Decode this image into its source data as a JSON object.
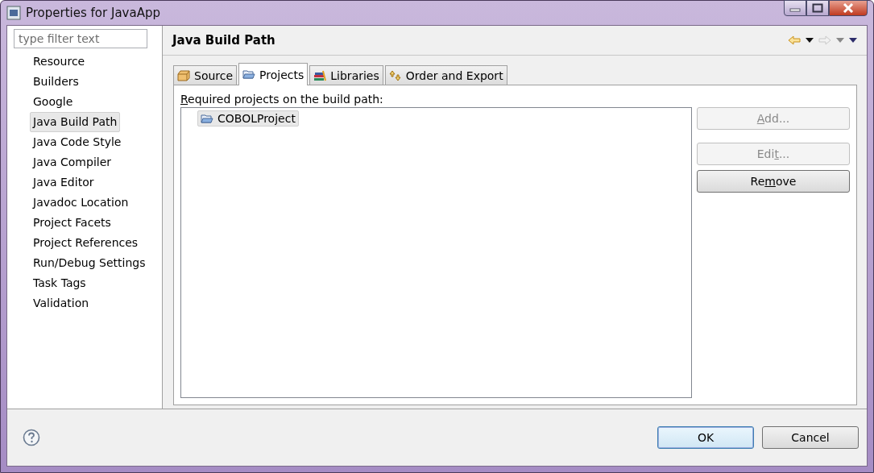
{
  "window": {
    "title": "Properties for JavaApp"
  },
  "sidebar": {
    "filter_placeholder": "type filter text",
    "items": [
      {
        "label": "Resource",
        "selected": false
      },
      {
        "label": "Builders",
        "selected": false
      },
      {
        "label": "Google",
        "selected": false
      },
      {
        "label": "Java Build Path",
        "selected": true
      },
      {
        "label": "Java Code Style",
        "selected": false
      },
      {
        "label": "Java Compiler",
        "selected": false
      },
      {
        "label": "Java Editor",
        "selected": false
      },
      {
        "label": "Javadoc Location",
        "selected": false
      },
      {
        "label": "Project Facets",
        "selected": false
      },
      {
        "label": "Project References",
        "selected": false
      },
      {
        "label": "Run/Debug Settings",
        "selected": false
      },
      {
        "label": "Task Tags",
        "selected": false
      },
      {
        "label": "Validation",
        "selected": false
      }
    ]
  },
  "page": {
    "title": "Java Build Path",
    "back_enabled": true,
    "forward_enabled": false
  },
  "tabs": [
    {
      "label": "Source",
      "kind": "source",
      "selected": false
    },
    {
      "label": "Projects",
      "kind": "projects",
      "selected": true
    },
    {
      "label": "Libraries",
      "kind": "libraries",
      "selected": false
    },
    {
      "label": "Order and Export",
      "kind": "order",
      "selected": false
    }
  ],
  "projects_label": {
    "key": "R",
    "post": "equired projects on the build path:"
  },
  "projects": [
    {
      "label": "COBOLProject",
      "selected": true
    }
  ],
  "buttons": [
    {
      "key": "A",
      "post": "dd...",
      "disabled": true
    },
    {
      "pre": "Edi",
      "key": "t",
      "post": "...",
      "disabled": true
    },
    {
      "pre": "Re",
      "key": "m",
      "post": "ove",
      "disabled": false
    }
  ],
  "footer_buttons": [
    {
      "label": "OK",
      "default": true
    },
    {
      "label": "Cancel",
      "default": false
    }
  ]
}
